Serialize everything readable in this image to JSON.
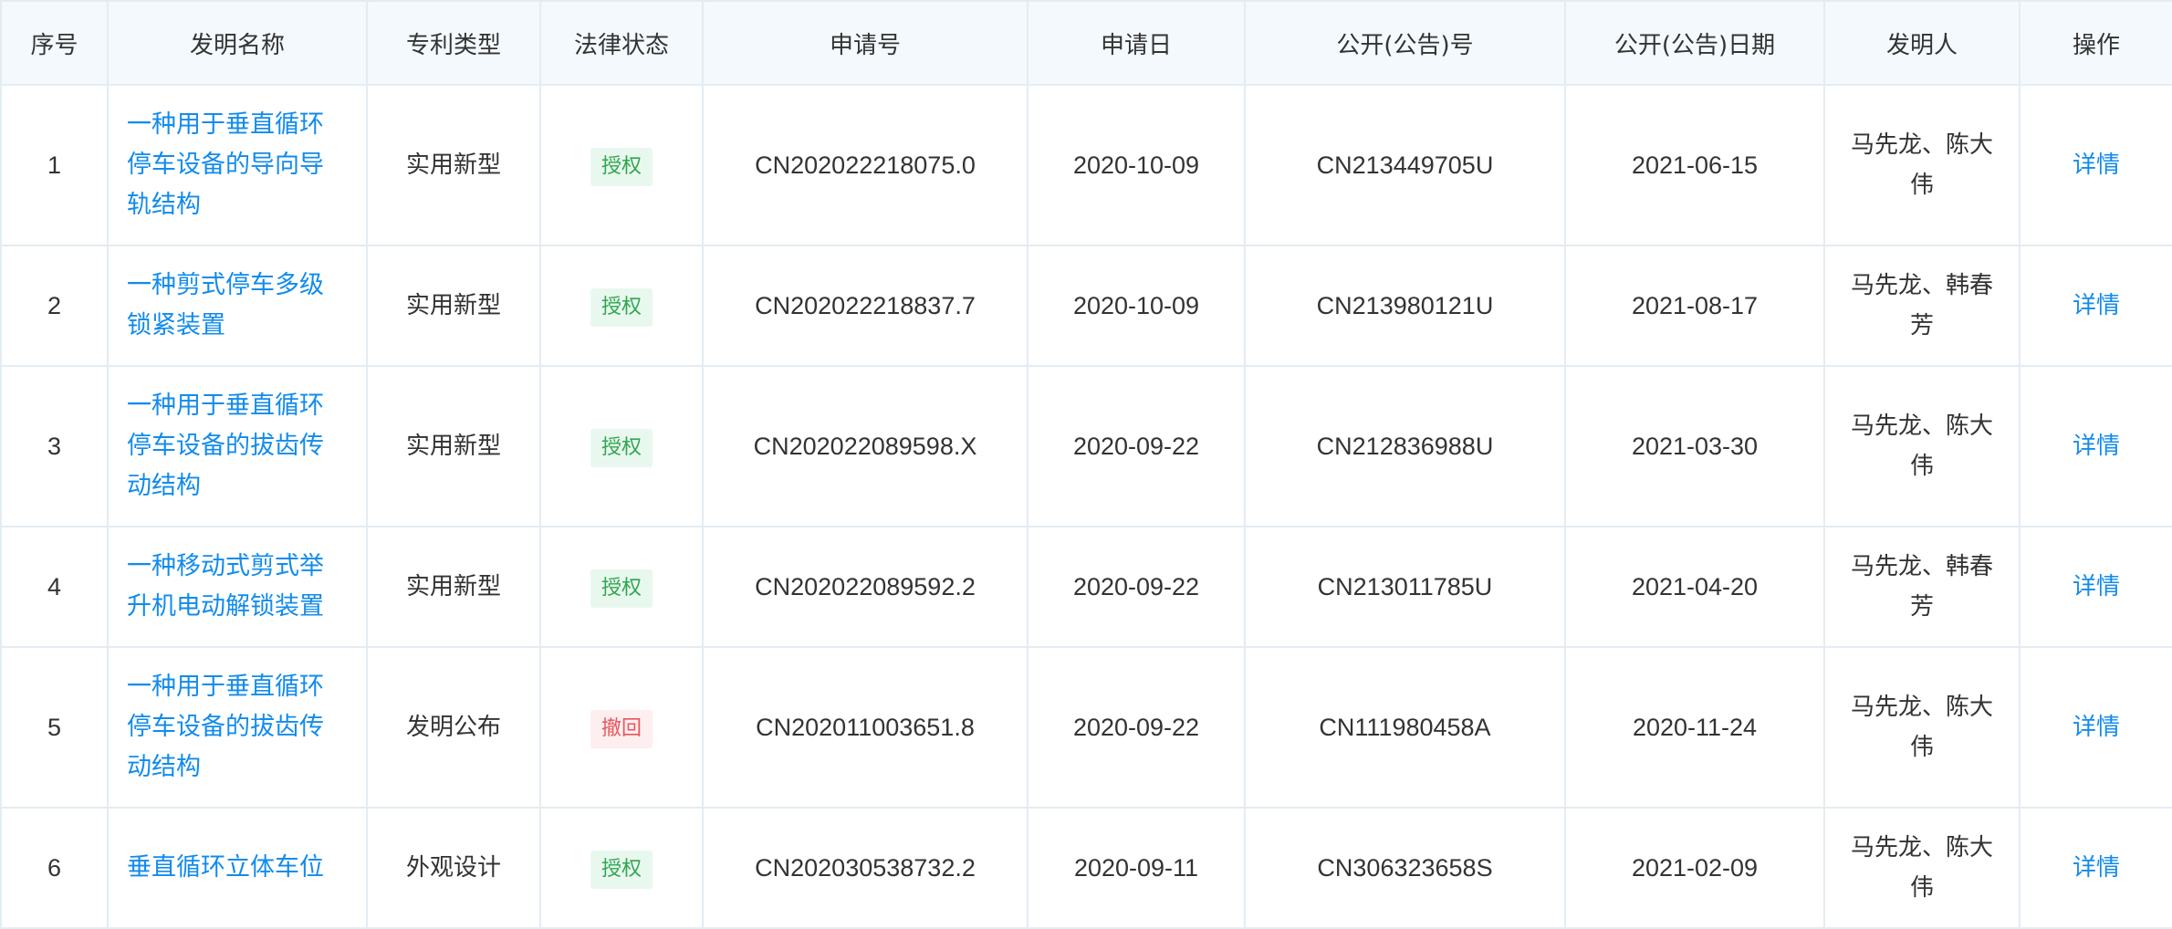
{
  "table": {
    "headers": [
      "序号",
      "发明名称",
      "专利类型",
      "法律状态",
      "申请号",
      "申请日",
      "公开(公告)号",
      "公开(公告)日期",
      "发明人",
      "操作"
    ],
    "rows": [
      {
        "index": "1",
        "name": "一种用于垂直循环停车设备的导向导轨结构",
        "type": "实用新型",
        "status": "授权",
        "app_no": "CN202022218075.0",
        "app_date": "2020-10-09",
        "pub_no": "CN213449705U",
        "pub_date": "2021-06-15",
        "inventors": "马先龙、陈大伟",
        "action": "详情"
      },
      {
        "index": "2",
        "name": "一种剪式停车多级锁紧装置",
        "type": "实用新型",
        "status": "授权",
        "app_no": "CN202022218837.7",
        "app_date": "2020-10-09",
        "pub_no": "CN213980121U",
        "pub_date": "2021-08-17",
        "inventors": "马先龙、韩春芳",
        "action": "详情"
      },
      {
        "index": "3",
        "name": "一种用于垂直循环停车设备的拔齿传动结构",
        "type": "实用新型",
        "status": "授权",
        "app_no": "CN202022089598.X",
        "app_date": "2020-09-22",
        "pub_no": "CN212836988U",
        "pub_date": "2021-03-30",
        "inventors": "马先龙、陈大伟",
        "action": "详情"
      },
      {
        "index": "4",
        "name": "一种移动式剪式举升机电动解锁装置",
        "type": "实用新型",
        "status": "授权",
        "app_no": "CN202022089592.2",
        "app_date": "2020-09-22",
        "pub_no": "CN213011785U",
        "pub_date": "2021-04-20",
        "inventors": "马先龙、韩春芳",
        "action": "详情"
      },
      {
        "index": "5",
        "name": "一种用于垂直循环停车设备的拔齿传动结构",
        "type": "发明公布",
        "status": "撤回",
        "app_no": "CN202011003651.8",
        "app_date": "2020-09-22",
        "pub_no": "CN111980458A",
        "pub_date": "2020-11-24",
        "inventors": "马先龙、陈大伟",
        "action": "详情"
      },
      {
        "index": "6",
        "name": "垂直循环立体车位",
        "type": "外观设计",
        "status": "授权",
        "app_no": "CN202030538732.2",
        "app_date": "2020-09-11",
        "pub_no": "CN306323658S",
        "pub_date": "2021-02-09",
        "inventors": "马先龙、陈大伟",
        "action": "详情"
      }
    ]
  },
  "colors": {
    "link": "#128bed",
    "header_bg": "#f3f9fd",
    "border": "#e4ecf3",
    "status_granted_bg": "#e9f8ef",
    "status_granted_fg": "#2fa64e",
    "status_withdrawn_bg": "#fdeef0",
    "status_withdrawn_fg": "#e8565b"
  }
}
